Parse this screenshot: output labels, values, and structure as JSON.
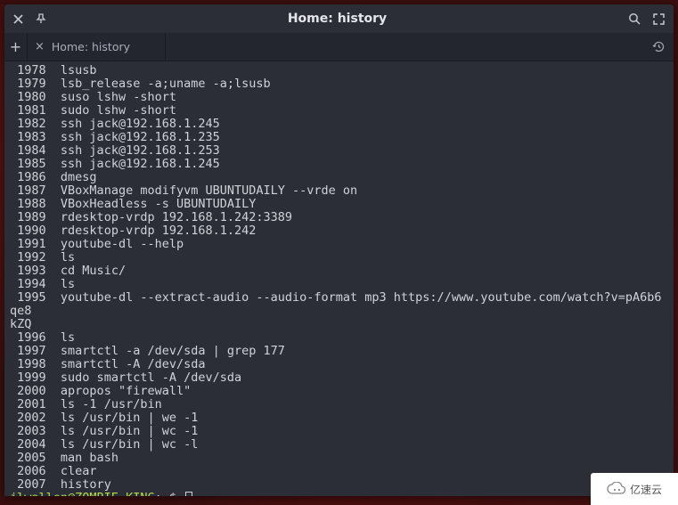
{
  "window": {
    "title": "Home: history"
  },
  "tab": {
    "label": "Home: history"
  },
  "history": [
    {
      "n": "1978",
      "cmd": "lsusb"
    },
    {
      "n": "1979",
      "cmd": "lsb_release -a;uname -a;lsusb"
    },
    {
      "n": "1980",
      "cmd": "suso lshw -short"
    },
    {
      "n": "1981",
      "cmd": "sudo lshw -short"
    },
    {
      "n": "1982",
      "cmd": "ssh jack@192.168.1.245"
    },
    {
      "n": "1983",
      "cmd": "ssh jack@192.168.1.235"
    },
    {
      "n": "1984",
      "cmd": "ssh jack@192.168.1.253"
    },
    {
      "n": "1985",
      "cmd": "ssh jack@192.168.1.245"
    },
    {
      "n": "1986",
      "cmd": "dmesg"
    },
    {
      "n": "1987",
      "cmd": "VBoxManage modifyvm UBUNTUDAILY --vrde on"
    },
    {
      "n": "1988",
      "cmd": "VBoxHeadless -s UBUNTUDAILY"
    },
    {
      "n": "1989",
      "cmd": "rdesktop-vrdp 192.168.1.242:3389"
    },
    {
      "n": "1990",
      "cmd": "rdesktop-vrdp 192.168.1.242"
    },
    {
      "n": "1991",
      "cmd": "youtube-dl --help"
    },
    {
      "n": "1992",
      "cmd": "ls"
    },
    {
      "n": "1993",
      "cmd": "cd Music/"
    },
    {
      "n": "1994",
      "cmd": "ls"
    },
    {
      "n": "1995",
      "cmd": "youtube-dl --extract-audio --audio-format mp3 https://www.youtube.com/watch?v=pA6b6qe8",
      "wrap": "kZQ"
    },
    {
      "n": "1996",
      "cmd": "ls"
    },
    {
      "n": "1997",
      "cmd": "smartctl -a /dev/sda | grep 177"
    },
    {
      "n": "1998",
      "cmd": "smartctl -A /dev/sda"
    },
    {
      "n": "1999",
      "cmd": "sudo smartctl -A /dev/sda"
    },
    {
      "n": "2000",
      "cmd": "apropos \"firewall\""
    },
    {
      "n": "2001",
      "cmd": "ls -1 /usr/bin"
    },
    {
      "n": "2002",
      "cmd": "ls /usr/bin | we -1"
    },
    {
      "n": "2003",
      "cmd": "ls /usr/bin | wc -1"
    },
    {
      "n": "2004",
      "cmd": "ls /usr/bin | wc -l"
    },
    {
      "n": "2005",
      "cmd": "man bash"
    },
    {
      "n": "2006",
      "cmd": "clear"
    },
    {
      "n": "2007",
      "cmd": "history"
    }
  ],
  "prompt": {
    "user": "jlwallen",
    "at": "@",
    "host": "ZOMBIE-KING",
    "sep": ":",
    "path": "~",
    "dollar": "$"
  },
  "watermark": {
    "text": "亿速云"
  }
}
